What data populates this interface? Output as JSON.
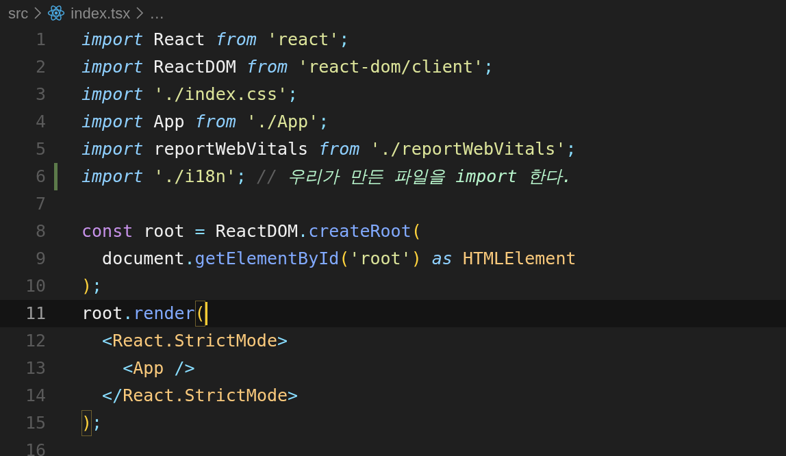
{
  "breadcrumb": {
    "folder": "src",
    "file": "index.tsx",
    "more": "…"
  },
  "lines": [
    {
      "number": "1",
      "modified": false,
      "current": false,
      "tokens": [
        {
          "text": "import",
          "kind": "keyword"
        },
        {
          "text": " React ",
          "kind": "plain"
        },
        {
          "text": "from ",
          "kind": "keyword"
        },
        {
          "text": "'react'",
          "kind": "string"
        },
        {
          "text": ";",
          "kind": "punct"
        }
      ]
    },
    {
      "number": "2",
      "modified": false,
      "current": false,
      "tokens": [
        {
          "text": "import",
          "kind": "keyword"
        },
        {
          "text": " ReactDOM ",
          "kind": "plain"
        },
        {
          "text": "from ",
          "kind": "keyword"
        },
        {
          "text": "'react-dom/client'",
          "kind": "string"
        },
        {
          "text": ";",
          "kind": "punct"
        }
      ]
    },
    {
      "number": "3",
      "modified": false,
      "current": false,
      "tokens": [
        {
          "text": "import ",
          "kind": "keyword"
        },
        {
          "text": "'./index.css'",
          "kind": "string"
        },
        {
          "text": ";",
          "kind": "punct"
        }
      ]
    },
    {
      "number": "4",
      "modified": false,
      "current": false,
      "tokens": [
        {
          "text": "import",
          "kind": "keyword"
        },
        {
          "text": " App ",
          "kind": "plain"
        },
        {
          "text": "from ",
          "kind": "keyword"
        },
        {
          "text": "'./App'",
          "kind": "string"
        },
        {
          "text": ";",
          "kind": "punct"
        }
      ]
    },
    {
      "number": "5",
      "modified": false,
      "current": false,
      "tokens": [
        {
          "text": "import",
          "kind": "keyword"
        },
        {
          "text": " reportWebVitals ",
          "kind": "plain"
        },
        {
          "text": "from ",
          "kind": "keyword"
        },
        {
          "text": "'./reportWebVitals'",
          "kind": "string"
        },
        {
          "text": ";",
          "kind": "punct"
        }
      ]
    },
    {
      "number": "6",
      "modified": true,
      "current": false,
      "tokens": [
        {
          "text": "import ",
          "kind": "keyword"
        },
        {
          "text": "'./i18n'",
          "kind": "string"
        },
        {
          "text": ";",
          "kind": "punct"
        },
        {
          "text": " // ",
          "kind": "comment"
        },
        {
          "text": "우리가 만든 파일을 import 한다.",
          "kind": "comment-text"
        }
      ]
    },
    {
      "number": "7",
      "modified": false,
      "current": false
    },
    {
      "number": "8",
      "modified": false,
      "current": false,
      "tokens": [
        {
          "text": "const",
          "kind": "storage"
        },
        {
          "text": " root ",
          "kind": "plain"
        },
        {
          "text": "=",
          "kind": "punct"
        },
        {
          "text": " ReactDOM",
          "kind": "plain"
        },
        {
          "text": ".",
          "kind": "punct"
        },
        {
          "text": "createRoot",
          "kind": "method"
        },
        {
          "text": "(",
          "kind": "bracket"
        }
      ]
    },
    {
      "number": "9",
      "modified": false,
      "current": false,
      "tokens": [
        {
          "text": "  document",
          "kind": "plain"
        },
        {
          "text": ".",
          "kind": "punct"
        },
        {
          "text": "getElementById",
          "kind": "method"
        },
        {
          "text": "(",
          "kind": "bracket"
        },
        {
          "text": "'root'",
          "kind": "string"
        },
        {
          "text": ")",
          "kind": "bracket"
        },
        {
          "text": " as ",
          "kind": "keyword"
        },
        {
          "text": "HTMLElement",
          "kind": "type"
        }
      ]
    },
    {
      "number": "10",
      "modified": false,
      "current": false,
      "tokens": [
        {
          "text": ")",
          "kind": "bracket"
        },
        {
          "text": ";",
          "kind": "punct"
        }
      ]
    },
    {
      "number": "11",
      "modified": false,
      "current": true,
      "tokens": [
        {
          "text": "root",
          "kind": "plain"
        },
        {
          "text": ".",
          "kind": "punct"
        },
        {
          "text": "render",
          "kind": "method"
        },
        {
          "text": "(",
          "kind": "bracket-match"
        }
      ]
    },
    {
      "number": "12",
      "modified": false,
      "current": false,
      "tokens": [
        {
          "text": "  <",
          "kind": "punct"
        },
        {
          "text": "React.StrictMode",
          "kind": "type"
        },
        {
          "text": ">",
          "kind": "punct"
        }
      ]
    },
    {
      "number": "13",
      "modified": false,
      "current": false,
      "tokens": [
        {
          "text": "    <",
          "kind": "punct"
        },
        {
          "text": "App",
          "kind": "type"
        },
        {
          "text": " />",
          "kind": "punct"
        }
      ]
    },
    {
      "number": "14",
      "modified": false,
      "current": false,
      "tokens": [
        {
          "text": "  </",
          "kind": "punct"
        },
        {
          "text": "React.StrictMode",
          "kind": "type"
        },
        {
          "text": ">",
          "kind": "punct"
        }
      ]
    },
    {
      "number": "15",
      "modified": false,
      "current": false,
      "tokens": [
        {
          "text": ")",
          "kind": "bracket-match"
        },
        {
          "text": ";",
          "kind": "punct"
        }
      ]
    },
    {
      "number": "16",
      "modified": false,
      "current": false
    }
  ]
}
